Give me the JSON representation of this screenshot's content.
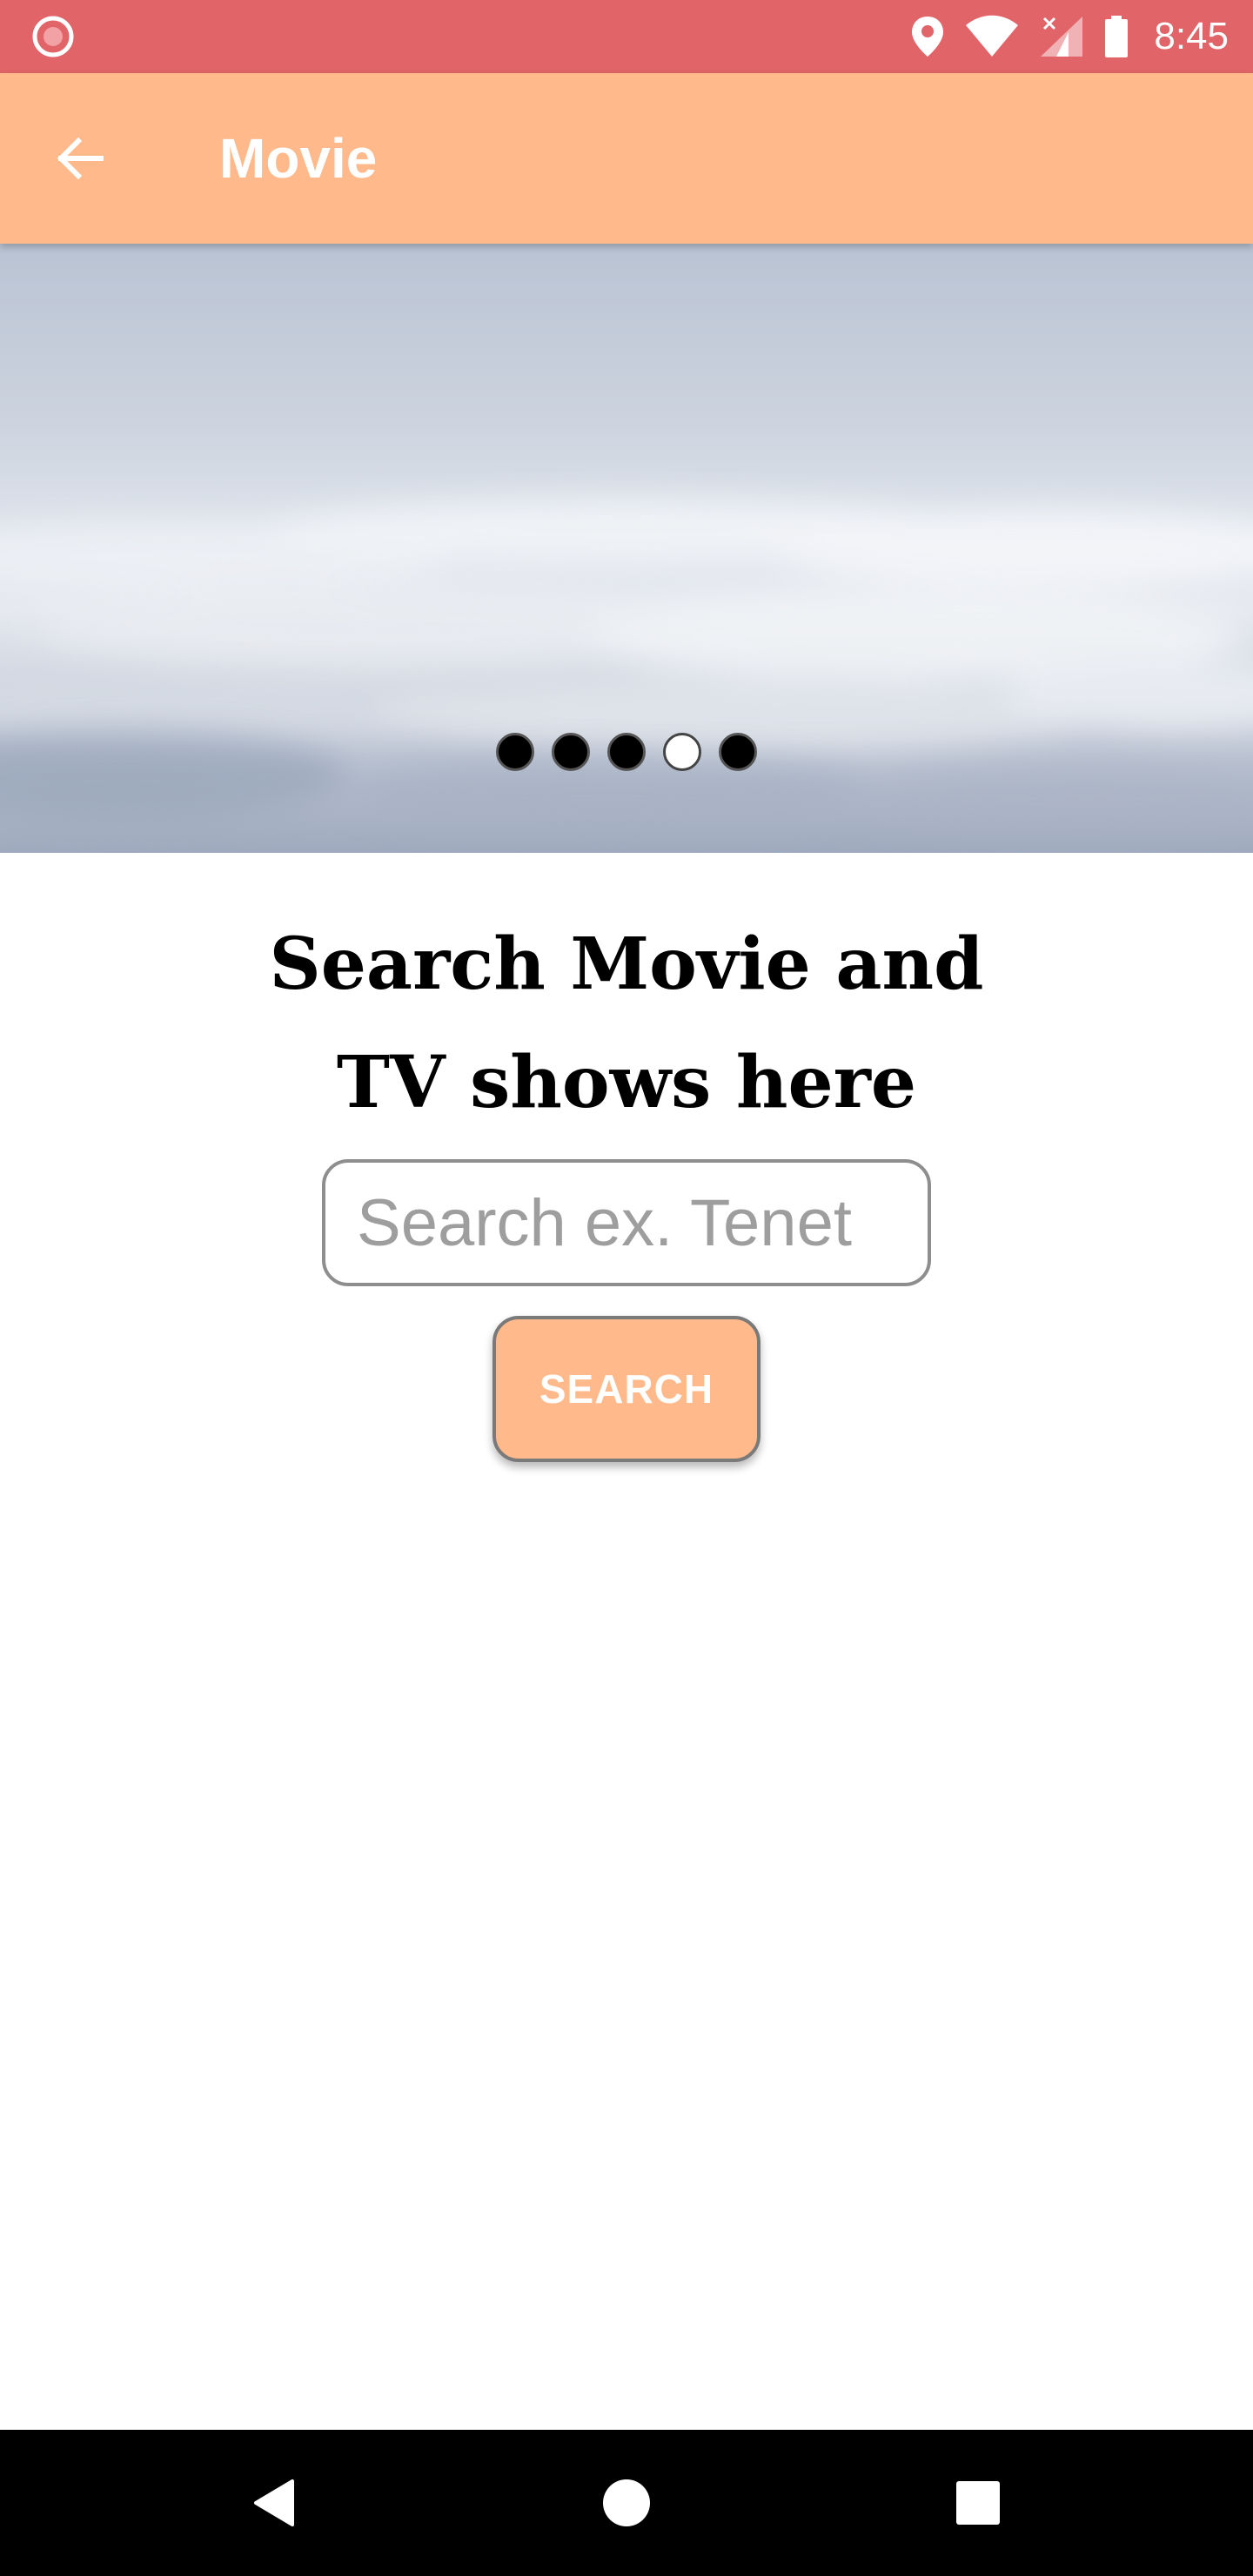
{
  "status_bar": {
    "time": "8:45",
    "left_icon": "record-icon",
    "icons": [
      "location-icon",
      "wifi-icon",
      "signal-icon",
      "battery-icon"
    ]
  },
  "app_bar": {
    "title": "Movie",
    "back_icon": "arrow-back-icon"
  },
  "carousel": {
    "slide_count": 5,
    "active_index": 3
  },
  "search": {
    "heading_line1": "Search Movie and",
    "heading_line2": "TV shows here",
    "input_value": "",
    "placeholder": "Search ex. Tenet",
    "button_label": "SEARCH"
  },
  "nav_bar": {
    "buttons": [
      "back-triangle-icon",
      "home-circle-icon",
      "recents-square-icon"
    ]
  },
  "colors": {
    "status_bar": "#e06468",
    "app_bar": "#ffb98a",
    "button": "#ffb98a",
    "nav_bar": "#000000"
  }
}
